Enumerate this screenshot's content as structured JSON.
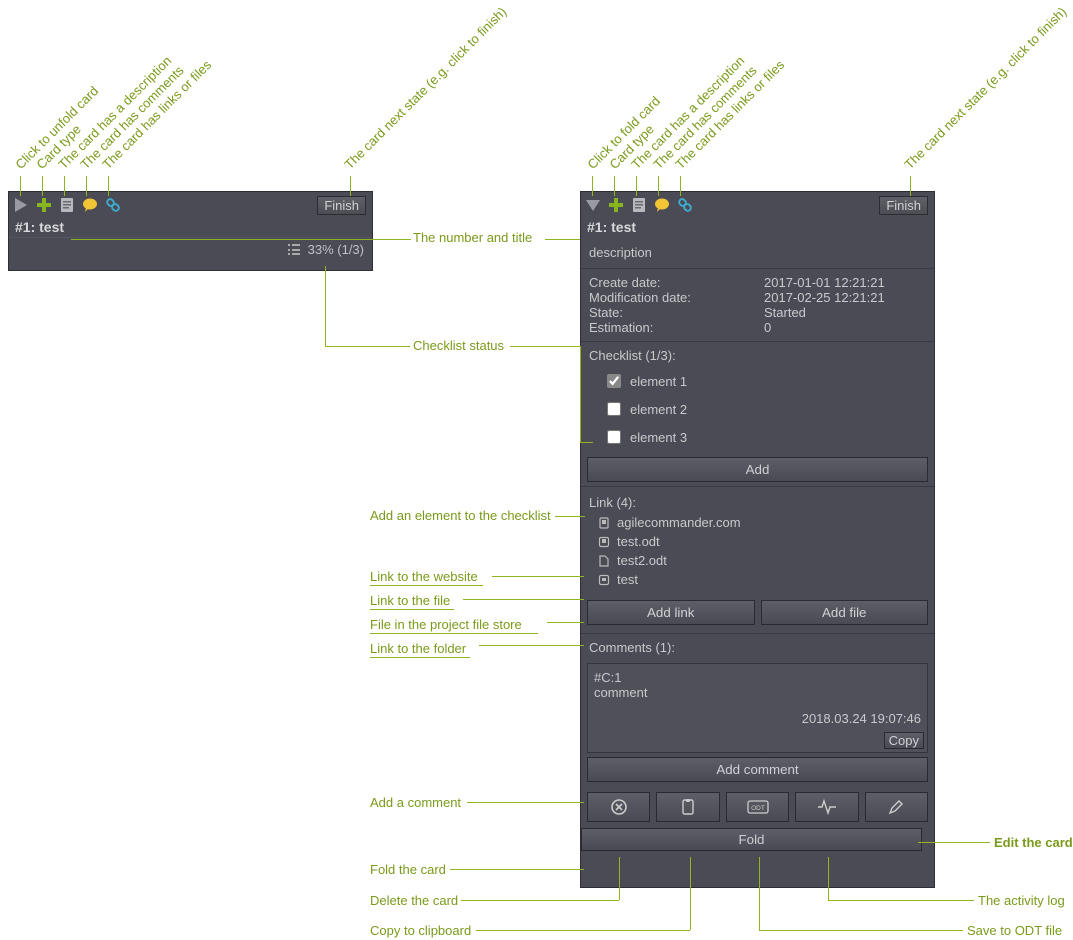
{
  "folded_card": {
    "finish_label": "Finish",
    "title": "#1: test",
    "checklist_percent": "33%",
    "checklist_fraction": "(1/3)"
  },
  "expanded_card": {
    "finish_label": "Finish",
    "title": "#1: test",
    "description": "description",
    "meta": {
      "create_label": "Create date:",
      "create_value": "2017-01-01 12:21:21",
      "mod_label": "Modification date:",
      "mod_value": "2017-02-25 12:21:21",
      "state_label": "State:",
      "state_value": "Started",
      "estimation_label": "Estimation:",
      "estimation_value": "0"
    },
    "checklist_heading": "Checklist (1/3):",
    "checklist": [
      {
        "label": "element 1",
        "checked": true
      },
      {
        "label": "element 2",
        "checked": false
      },
      {
        "label": "element 3",
        "checked": false
      }
    ],
    "add_checklist_label": "Add",
    "links_heading": "Link (4):",
    "links": [
      {
        "label": "agilecommander.com",
        "kind": "web"
      },
      {
        "label": "test.odt",
        "kind": "file"
      },
      {
        "label": "test2.odt",
        "kind": "store"
      },
      {
        "label": "test",
        "kind": "folder"
      }
    ],
    "add_link_label": "Add link",
    "add_file_label": "Add file",
    "comments_heading": "Comments (1):",
    "comment_id": "#C:1",
    "comment_text": "comment",
    "comment_date": "2018.03.24 19:07:46",
    "copy_label": "Copy",
    "add_comment_label": "Add comment",
    "fold_label": "Fold"
  },
  "annotations": {
    "left_rotated": [
      "Click to unfold card",
      "Card type",
      "The card has a description",
      "The card has comments",
      "The card has links or files",
      "The card next state (e.g. click to finish)"
    ],
    "right_rotated": [
      "Click to fold card",
      "Card type",
      "The card has a description",
      "The card has comments",
      "The card has links or files",
      "The card next state (e.g. click to finish)"
    ],
    "middle": {
      "title": "The number and title",
      "checklist": "Checklist status",
      "add_checklist": "Add an element to the checklist",
      "link_web": "Link to the website",
      "link_file": "Link to the file",
      "link_store": "File in the project file store",
      "link_folder": "Link to the folder",
      "add_comment": "Add a comment",
      "fold": "Fold the card",
      "delete": "Delete the card",
      "copy": "Copy to clipboard"
    },
    "right_side": {
      "edit": "Edit the card",
      "activity": "The activity log",
      "save_odt": "Save to ODT file"
    }
  }
}
